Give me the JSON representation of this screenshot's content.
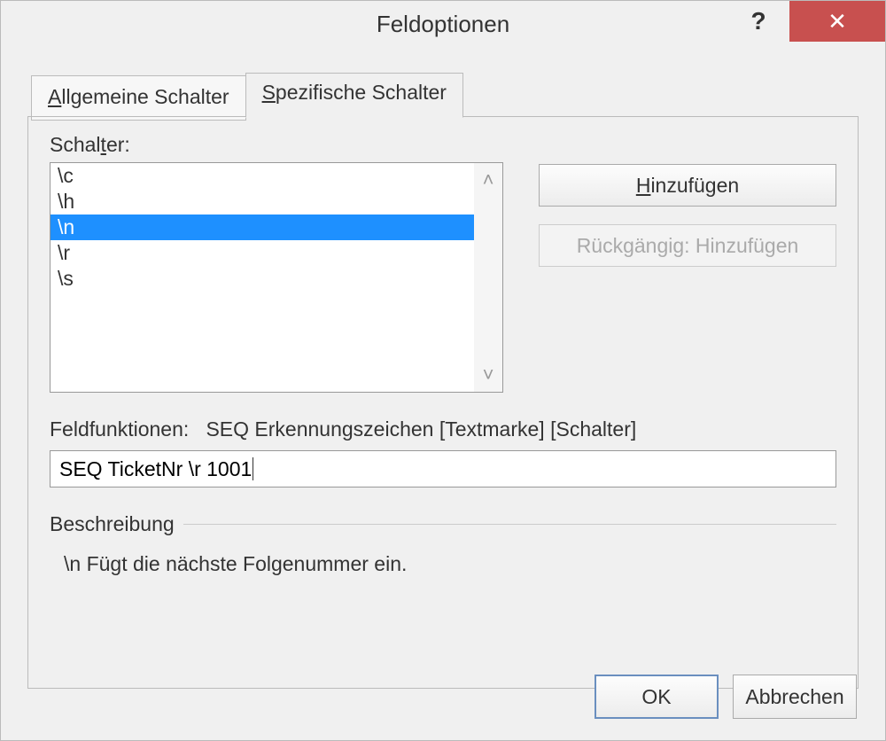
{
  "dialog": {
    "title": "Feldoptionen",
    "help_label": "?",
    "close_label": "✕"
  },
  "tabs": {
    "general": "Allgemeine Schalter",
    "specific": "Spezifische Schalter"
  },
  "switches": {
    "label": "Schalter:",
    "items": [
      "\\c",
      "\\h",
      "\\n",
      "\\r",
      "\\s"
    ],
    "selected_index": 2
  },
  "buttons": {
    "add": "Hinzufügen",
    "undo_add": "Rückgängig: Hinzufügen",
    "ok": "OK",
    "cancel": "Abbrechen"
  },
  "field_functions": {
    "label": "Feldfunktionen:",
    "syntax": "SEQ Erkennungszeichen [Textmarke] [Schalter]",
    "value": "SEQ TicketNr \\r 1001"
  },
  "description": {
    "label": "Beschreibung",
    "text": "\\n Fügt die nächste Folgenummer ein."
  }
}
